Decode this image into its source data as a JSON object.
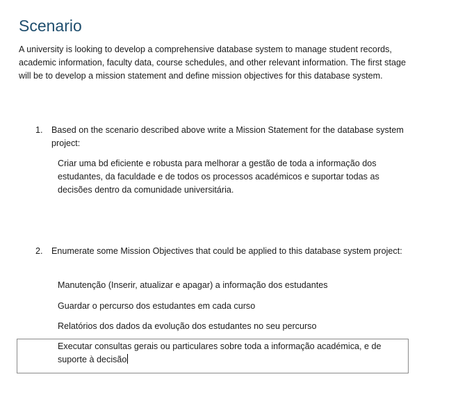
{
  "document": {
    "heading": "Scenario",
    "intro": "A university is looking to develop a comprehensive database system to manage student records, academic information, faculty data, course schedules, and other relevant information. The first stage will be to develop a mission statement and define mission objectives for this database system.",
    "questions": [
      {
        "number": "1.",
        "text": "Based on the scenario described above write a Mission Statement for the database system project:",
        "answer": "Criar uma bd eficiente e robusta para melhorar a gestão de toda a informação dos estudantes, da faculdade e de todos os processos académicos e suportar todas as decisões dentro da comunidade universitária."
      },
      {
        "number": "2.",
        "text": "Enumerate some Mission Objectives that could be applied to this database system project:",
        "objectives": [
          "Manutenção (Inserir, atualizar e apagar) a informação dos estudantes",
          "Guardar o percurso dos estudantes em cada curso",
          "Relatórios dos dados da evolução dos estudantes no seu percurso",
          "Executar consultas gerais ou particulares sobre toda a informação académica, e de suporte à decisão"
        ]
      }
    ]
  }
}
